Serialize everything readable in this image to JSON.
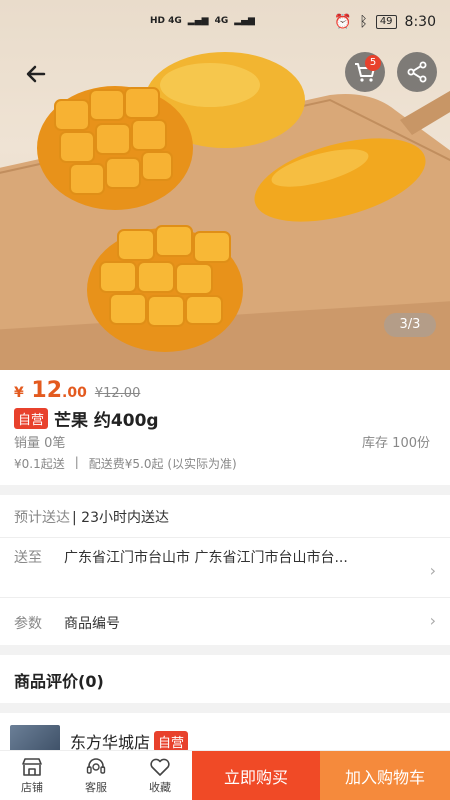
{
  "status_bar": {
    "network_left": "HD 4G",
    "network_right": "4G",
    "battery": "49",
    "time": "8:30"
  },
  "header": {
    "cart_count": "5",
    "image_counter": "3/3"
  },
  "product": {
    "currency": "¥",
    "price_int": "12",
    "price_dec": ".00",
    "original_price": "¥12.00",
    "tag": "自营",
    "title": "芒果 约400g",
    "sales": "销量 0笔",
    "stock": "库存 100份",
    "min_order": "¥0.1起送",
    "separator": "|",
    "delivery_fee": "配送费¥5.0起 (以实际为准)"
  },
  "delivery": {
    "eta_label": "预计送达",
    "eta_value": "| 23小时内送达",
    "ship_to_label": "送至",
    "ship_to_value": "广东省江门市台山市 广东省江门市台山市台...",
    "params_label": "参数",
    "params_value": "商品编号"
  },
  "reviews": {
    "title": "商品评价(0)"
  },
  "store": {
    "name": "东方华城店",
    "tag": "自营"
  },
  "bottom_bar": {
    "store_label": "店铺",
    "service_label": "客服",
    "favorite_label": "收藏",
    "buy_now": "立即购买",
    "add_to_cart": "加入购物车"
  }
}
